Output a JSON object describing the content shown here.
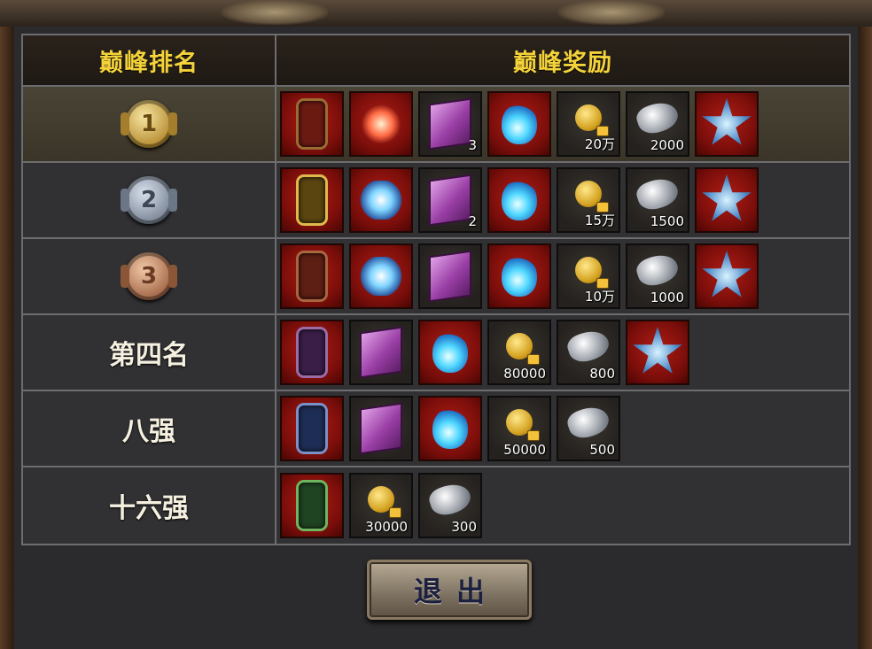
{
  "header": {
    "rank_label": "巅峰排名",
    "reward_label": "巅峰奖励"
  },
  "exit_button": "退出",
  "colors": {
    "header_text": "#f4d23a",
    "rank_text": "#f5f0e0",
    "slot_red": "#7a0e0a",
    "slot_dark": "#24211e"
  },
  "rows": [
    {
      "rank_type": "medal",
      "rank": "1",
      "medal": "gold-medal-icon",
      "rewards": [
        {
          "icon": "title-token-icon",
          "qty": ""
        },
        {
          "icon": "wing-red-icon",
          "qty": ""
        },
        {
          "icon": "purple-chest-icon",
          "qty": "3"
        },
        {
          "icon": "blue-flame-icon",
          "qty": ""
        },
        {
          "icon": "bound-gold-icon",
          "qty": "20万"
        },
        {
          "icon": "silver-ore-icon",
          "qty": "2000"
        },
        {
          "icon": "star-emblem-icon",
          "qty": ""
        }
      ]
    },
    {
      "rank_type": "medal",
      "rank": "2",
      "medal": "silver-medal-icon",
      "rewards": [
        {
          "icon": "title-token-icon",
          "qty": ""
        },
        {
          "icon": "wing-blue-icon",
          "qty": ""
        },
        {
          "icon": "purple-chest-icon",
          "qty": "2"
        },
        {
          "icon": "blue-flame-icon",
          "qty": ""
        },
        {
          "icon": "bound-gold-icon",
          "qty": "15万"
        },
        {
          "icon": "silver-ore-icon",
          "qty": "1500"
        },
        {
          "icon": "star-emblem-icon",
          "qty": ""
        }
      ]
    },
    {
      "rank_type": "medal",
      "rank": "3",
      "medal": "bronze-medal-icon",
      "rewards": [
        {
          "icon": "title-token-icon",
          "qty": ""
        },
        {
          "icon": "wing-blue-icon",
          "qty": ""
        },
        {
          "icon": "purple-chest-icon",
          "qty": ""
        },
        {
          "icon": "blue-flame-icon",
          "qty": ""
        },
        {
          "icon": "bound-gold-icon",
          "qty": "10万"
        },
        {
          "icon": "silver-ore-icon",
          "qty": "1000"
        },
        {
          "icon": "star-emblem-icon",
          "qty": ""
        }
      ]
    },
    {
      "rank_type": "text",
      "rank": "第四名",
      "rewards": [
        {
          "icon": "title-token-icon",
          "qty": ""
        },
        {
          "icon": "purple-chest-icon",
          "qty": ""
        },
        {
          "icon": "blue-flame-icon",
          "qty": ""
        },
        {
          "icon": "bound-gold-icon",
          "qty": "80000"
        },
        {
          "icon": "silver-ore-icon",
          "qty": "800"
        },
        {
          "icon": "star-emblem-icon",
          "qty": ""
        }
      ]
    },
    {
      "rank_type": "text",
      "rank": "八强",
      "rewards": [
        {
          "icon": "title-token-icon",
          "qty": ""
        },
        {
          "icon": "purple-chest-icon",
          "qty": ""
        },
        {
          "icon": "blue-flame-icon",
          "qty": ""
        },
        {
          "icon": "bound-gold-icon",
          "qty": "50000"
        },
        {
          "icon": "silver-ore-icon",
          "qty": "500"
        }
      ]
    },
    {
      "rank_type": "text",
      "rank": "十六强",
      "rewards": [
        {
          "icon": "title-token-icon",
          "qty": ""
        },
        {
          "icon": "bound-gold-icon",
          "qty": "30000"
        },
        {
          "icon": "silver-ore-icon",
          "qty": "300"
        }
      ]
    }
  ]
}
